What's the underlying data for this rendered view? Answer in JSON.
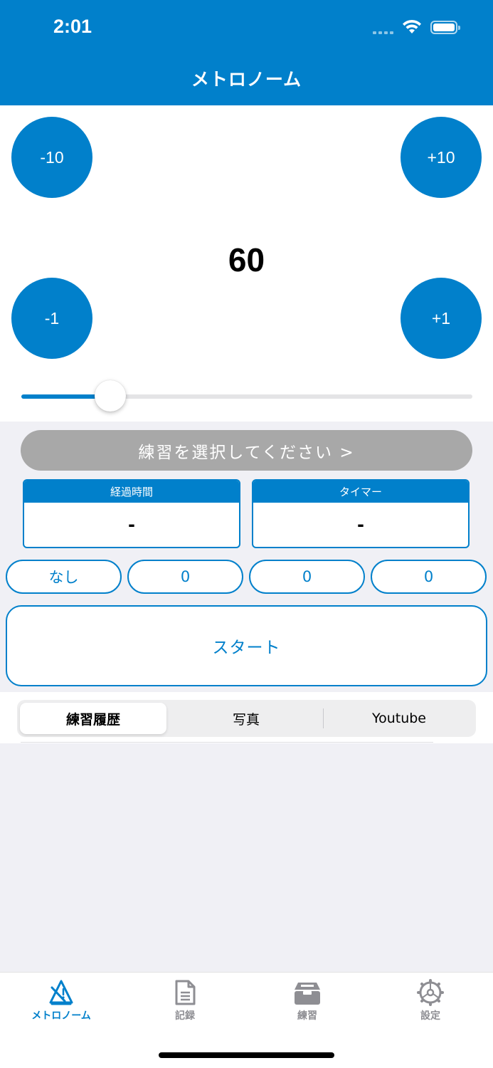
{
  "status_bar": {
    "time": "2:01"
  },
  "nav": {
    "title": "メトロノーム"
  },
  "metronome": {
    "minus10_label": "-10",
    "plus10_label": "+10",
    "minus1_label": "-1",
    "plus1_label": "+1",
    "tempo": "60",
    "slider_fraction": 0.197
  },
  "practice": {
    "select_label": "練習を選択してください >",
    "elapsed": {
      "caption": "経過時間",
      "value": "-"
    },
    "timer": {
      "caption": "タイマー",
      "value": "-"
    },
    "counters": [
      "なし",
      "0",
      "0",
      "0"
    ],
    "start_label": "スタート"
  },
  "segments": {
    "items": [
      "練習履歴",
      "写真",
      "Youtube"
    ],
    "selected": 0
  },
  "tabbar": {
    "items": [
      {
        "label": "メトロノーム",
        "icon": "metronome-icon",
        "active": true
      },
      {
        "label": "記録",
        "icon": "document-icon",
        "active": false
      },
      {
        "label": "練習",
        "icon": "tray-icon",
        "active": false
      },
      {
        "label": "設定",
        "icon": "gear-icon",
        "active": false
      }
    ]
  },
  "colors": {
    "accent": "#0180cb",
    "inactive": "#8e8e93",
    "disabled_button": "#a8a8a8",
    "background": "#f0f0f5"
  }
}
